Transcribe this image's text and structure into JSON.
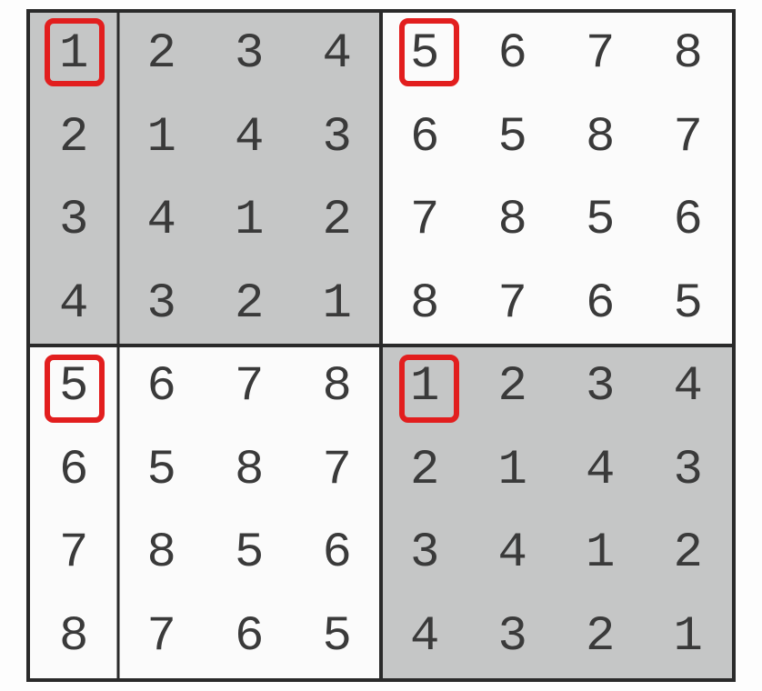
{
  "grid": {
    "size": 8,
    "rows": [
      [
        1,
        2,
        3,
        4,
        5,
        6,
        7,
        8
      ],
      [
        2,
        1,
        4,
        3,
        6,
        5,
        8,
        7
      ],
      [
        3,
        4,
        1,
        2,
        7,
        8,
        5,
        6
      ],
      [
        4,
        3,
        2,
        1,
        8,
        7,
        6,
        5
      ],
      [
        5,
        6,
        7,
        8,
        1,
        2,
        3,
        4
      ],
      [
        6,
        5,
        8,
        7,
        2,
        1,
        4,
        3
      ],
      [
        7,
        8,
        5,
        6,
        3,
        4,
        1,
        2
      ],
      [
        8,
        7,
        6,
        5,
        4,
        3,
        2,
        1
      ]
    ],
    "shaded_quadrants": [
      "top-left",
      "bottom-right"
    ],
    "highlighted_cells": [
      {
        "row": 0,
        "col": 0
      },
      {
        "row": 0,
        "col": 4
      },
      {
        "row": 4,
        "col": 0
      },
      {
        "row": 4,
        "col": 4
      }
    ],
    "highlight_color": "#e21e1e"
  }
}
